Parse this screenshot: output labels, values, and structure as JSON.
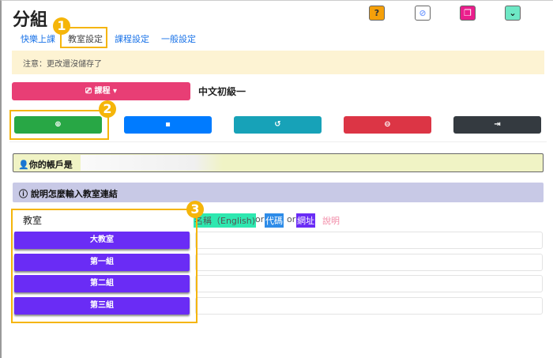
{
  "header": {
    "title": "分組"
  },
  "top_icons": [
    {
      "name": "help-icon",
      "glyph": "?",
      "color": "#f5a00a"
    },
    {
      "name": "eye-slash-icon",
      "glyph": "⊘",
      "color": "#ffffff"
    },
    {
      "name": "copy-icon",
      "glyph": "❐",
      "color": "#ea1e8c"
    },
    {
      "name": "chevron-down-icon",
      "glyph": "⌄",
      "color": "#6ee8c5"
    }
  ],
  "tabs": [
    {
      "label": "快樂上課"
    },
    {
      "label": "教室設定",
      "active": true
    },
    {
      "label": "課程設定"
    },
    {
      "label": "一般設定"
    }
  ],
  "notice": "注意：更改還沒儲存了",
  "course": {
    "button_label": "課程",
    "current": "中文初級一"
  },
  "actions": [
    {
      "name": "add",
      "glyph": "⊕",
      "color": "#28a745"
    },
    {
      "name": "save",
      "glyph": "💾",
      "color": "#007bff"
    },
    {
      "name": "undo",
      "glyph": "↺",
      "color": "#17a2b8"
    },
    {
      "name": "remove",
      "glyph": "⊖",
      "color": "#dc3545"
    },
    {
      "name": "export",
      "glyph": "⇥",
      "color": "#343a40"
    }
  ],
  "account": {
    "label": "你的帳戶是"
  },
  "info": {
    "label": "說明怎麼輸入教室連結"
  },
  "rooms": {
    "header": "教室",
    "items": [
      "大教室",
      "第一組",
      "第二組",
      "第三組"
    ],
    "hint": {
      "name": "名稱（English)",
      "or1": "or",
      "code": "代碼",
      "or2": "or",
      "url": "網址",
      "help": "說明"
    }
  },
  "annotations": [
    "1",
    "2",
    "3"
  ]
}
